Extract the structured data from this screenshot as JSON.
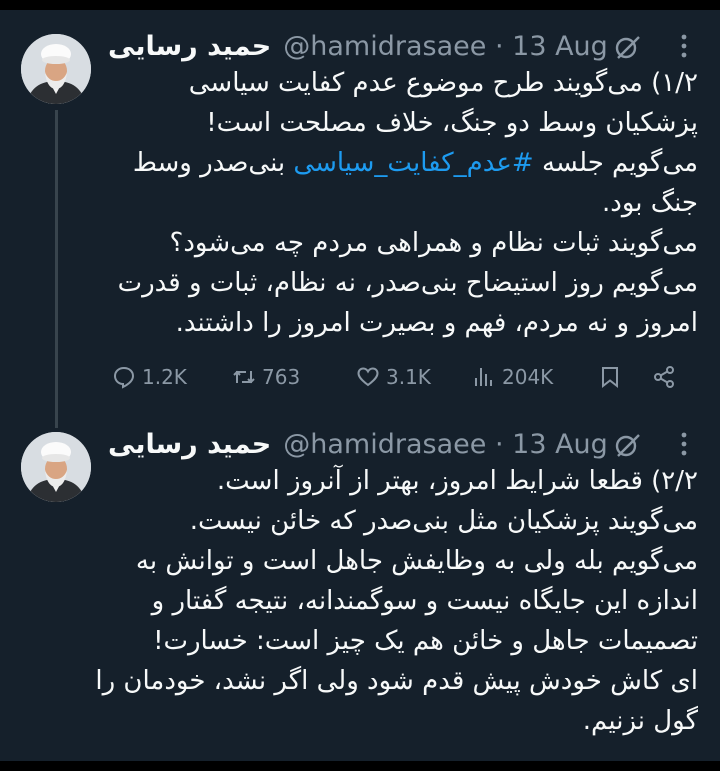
{
  "tweets": [
    {
      "author_name": "حمید رسایی",
      "handle": "@hamidrasaee",
      "separator": "·",
      "date": "13 Aug",
      "lines": [
        "۱/۲) می‌گویند طرح موضوع عدم کفایت سیاسی",
        "پزشکیان وسط دو جنگ، خلاف مصلحت است!",
        {
          "before": "می‌گویم جلسه ",
          "hashtag": "#عدم_کفایت_سیاسی",
          "after": " بنی‌صدر وسط"
        },
        "جنگ بود.",
        "می‌گویند ثبات نظام و همراهی مردم چه می‌شود؟",
        "می‌گویم روز استیضاح بنی‌صدر، نه نظام، ثبات و قدرت",
        "امروز و نه مردم، فهم و بصیرت امروز را داشتند."
      ],
      "stats": {
        "replies": "1.2K",
        "retweets": "763",
        "likes": "3.1K",
        "views": "204K"
      }
    },
    {
      "author_name": "حمید رسایی",
      "handle": "@hamidrasaee",
      "separator": "·",
      "date": "13 Aug",
      "lines": [
        "۲/۲) قطعا شرایط امروز، بهتر از آنروز است.",
        "می‌گویند پزشکیان مثل بنی‌صدر که خائن نیست.",
        "می‌گویم بله ولی به وظایفش جاهل است و توانش به",
        "اندازه این جایگاه نیست و سوگمندانه، نتیجه گفتار و",
        "تصمیمات جاهل و خائن هم یک چیز است: خسارت!",
        "ای کاش خودش پیش قدم شود ولی اگر نشد، خودمان را",
        "گول نزنیم."
      ]
    }
  ],
  "icons": {
    "avatar": "avatar-cleric",
    "grok": "grok-icon",
    "more": "more-icon",
    "reply": "reply-icon",
    "retweet": "retweet-icon",
    "like": "like-icon",
    "views": "views-icon",
    "bookmark": "bookmark-icon",
    "share": "share-icon"
  },
  "colors": {
    "background": "#15202b",
    "text": "#f7f9f9",
    "secondary": "#8b98a5",
    "hashtag": "#1d9bf0",
    "thread_line": "#38444d"
  }
}
